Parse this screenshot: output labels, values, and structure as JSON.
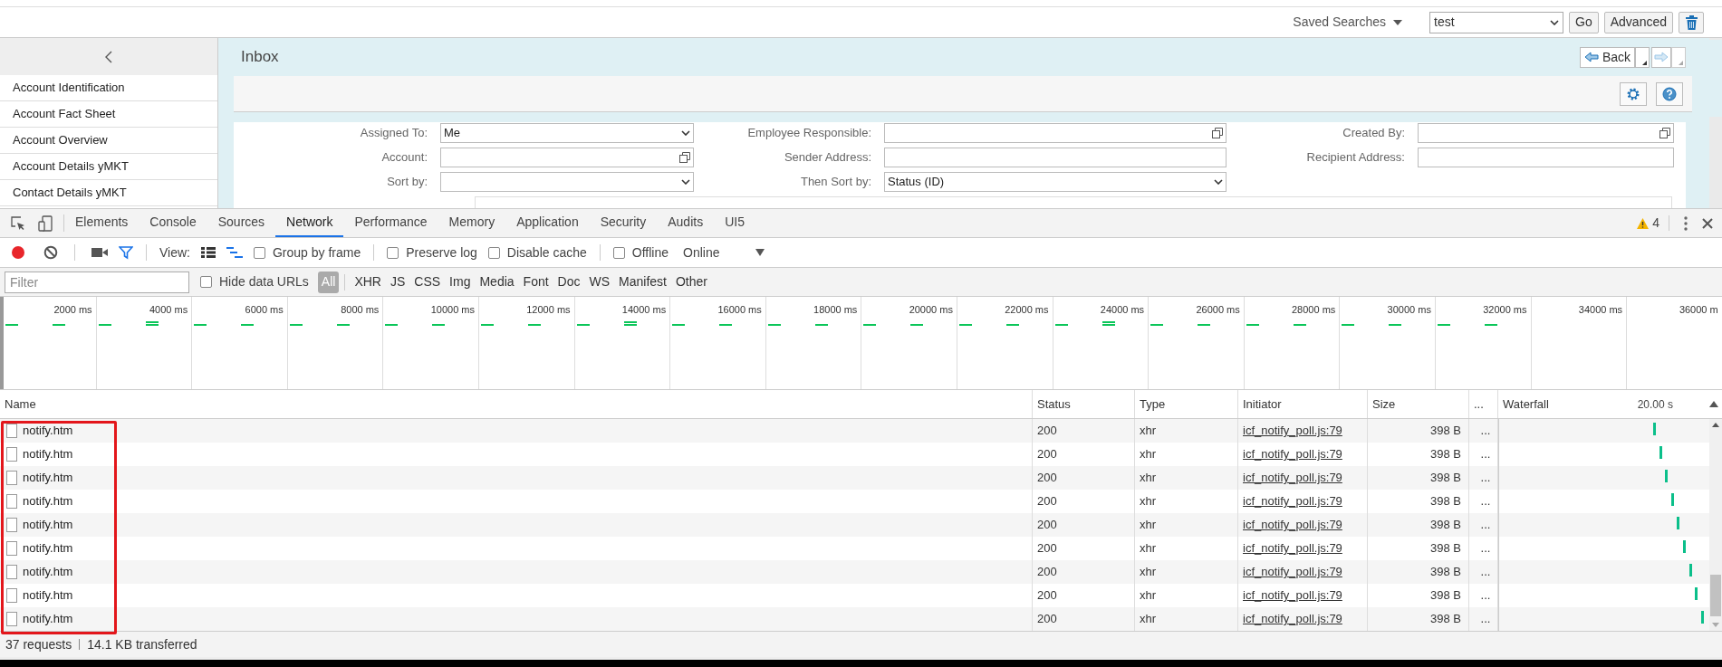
{
  "toolbar": {
    "saved_searches_label": "Saved Searches",
    "saved_search": "test",
    "buttons": [
      "Go",
      "Advanced"
    ]
  },
  "sidebar": {
    "items": [
      "Account Identification",
      "Account Fact Sheet",
      "Account Overview",
      "Account Details yMKT",
      "Contact Details yMKT"
    ]
  },
  "page": {
    "title": "Inbox",
    "back_button": "Back"
  },
  "search_form": {
    "rows": [
      [
        {
          "label": "Assigned To:",
          "value": "Me",
          "kind": "dropdown"
        },
        {
          "label": "Employee Responsible:",
          "kind": "picker"
        },
        {
          "label": "Created By:",
          "kind": "picker"
        }
      ],
      [
        {
          "label": "Account:",
          "kind": "picker"
        },
        {
          "label": "Sender Address:",
          "kind": "text"
        },
        {
          "label": "Recipient Address:",
          "kind": "text"
        }
      ],
      [
        {
          "label": "Sort by:",
          "kind": "dropdown"
        },
        {
          "label": "Then Sort by:",
          "value": "Status (ID)",
          "kind": "dropdown"
        }
      ]
    ]
  },
  "devtools": {
    "tabs": [
      {
        "label": "Elements",
        "selected": false
      },
      {
        "label": "Console",
        "selected": false
      },
      {
        "label": "Sources",
        "selected": false
      },
      {
        "label": "Network",
        "selected": true
      },
      {
        "label": "Performance",
        "selected": false
      },
      {
        "label": "Memory",
        "selected": false
      },
      {
        "label": "Application",
        "selected": false
      },
      {
        "label": "Security",
        "selected": false
      },
      {
        "label": "Audits",
        "selected": false
      },
      {
        "label": "UI5",
        "selected": false
      }
    ],
    "warning_count": "4",
    "recording": true,
    "view_label": "View:",
    "checkboxes": [
      {
        "label": "Group by frame",
        "checked": false
      },
      {
        "label": "Preserve log",
        "checked": false
      },
      {
        "label": "Disable cache",
        "checked": false
      },
      {
        "label": "Offline",
        "checked": false
      }
    ],
    "throttling": "Online",
    "filter": {
      "placeholder": "Filter",
      "hide_data_urls": {
        "label": "Hide data URLs",
        "checked": false
      },
      "types": [
        {
          "label": "All",
          "selected": true
        },
        {
          "label": "XHR",
          "selected": false
        },
        {
          "label": "JS",
          "selected": false
        },
        {
          "label": "CSS",
          "selected": false
        },
        {
          "label": "Img",
          "selected": false
        },
        {
          "label": "Media",
          "selected": false
        },
        {
          "label": "Font",
          "selected": false
        },
        {
          "label": "Doc",
          "selected": false
        },
        {
          "label": "WS",
          "selected": false
        },
        {
          "label": "Manifest",
          "selected": false
        },
        {
          "label": "Other",
          "selected": false
        }
      ]
    },
    "overview_ticks": [
      "2000 ms",
      "4000 ms",
      "6000 ms",
      "8000 ms",
      "10000 ms",
      "12000 ms",
      "14000 ms",
      "16000 ms",
      "18000 ms",
      "20000 ms",
      "22000 ms",
      "24000 ms",
      "26000 ms",
      "28000 ms",
      "30000 ms",
      "32000 ms",
      "34000 ms",
      "36000 m"
    ],
    "table": {
      "columns": [
        "Name",
        "Status",
        "Type",
        "Initiator",
        "Size",
        "...",
        "Waterfall"
      ],
      "waterfall_scale": "20.00 s",
      "rows": [
        {
          "name": "notify.htm",
          "status": "200",
          "type": "xhr",
          "initiator": "icf_notify_poll.js:79",
          "size": "398 B",
          "more": "..."
        },
        {
          "name": "notify.htm",
          "status": "200",
          "type": "xhr",
          "initiator": "icf_notify_poll.js:79",
          "size": "398 B",
          "more": "..."
        },
        {
          "name": "notify.htm",
          "status": "200",
          "type": "xhr",
          "initiator": "icf_notify_poll.js:79",
          "size": "398 B",
          "more": "..."
        },
        {
          "name": "notify.htm",
          "status": "200",
          "type": "xhr",
          "initiator": "icf_notify_poll.js:79",
          "size": "398 B",
          "more": "..."
        },
        {
          "name": "notify.htm",
          "status": "200",
          "type": "xhr",
          "initiator": "icf_notify_poll.js:79",
          "size": "398 B",
          "more": "..."
        },
        {
          "name": "notify.htm",
          "status": "200",
          "type": "xhr",
          "initiator": "icf_notify_poll.js:79",
          "size": "398 B",
          "more": "..."
        },
        {
          "name": "notify.htm",
          "status": "200",
          "type": "xhr",
          "initiator": "icf_notify_poll.js:79",
          "size": "398 B",
          "more": "..."
        },
        {
          "name": "notify.htm",
          "status": "200",
          "type": "xhr",
          "initiator": "icf_notify_poll.js:79",
          "size": "398 B",
          "more": "..."
        },
        {
          "name": "notify.htm",
          "status": "200",
          "type": "xhr",
          "initiator": "icf_notify_poll.js:79",
          "size": "398 B",
          "more": "..."
        }
      ]
    },
    "summary": [
      "37 requests",
      "14.1 KB transferred"
    ]
  }
}
